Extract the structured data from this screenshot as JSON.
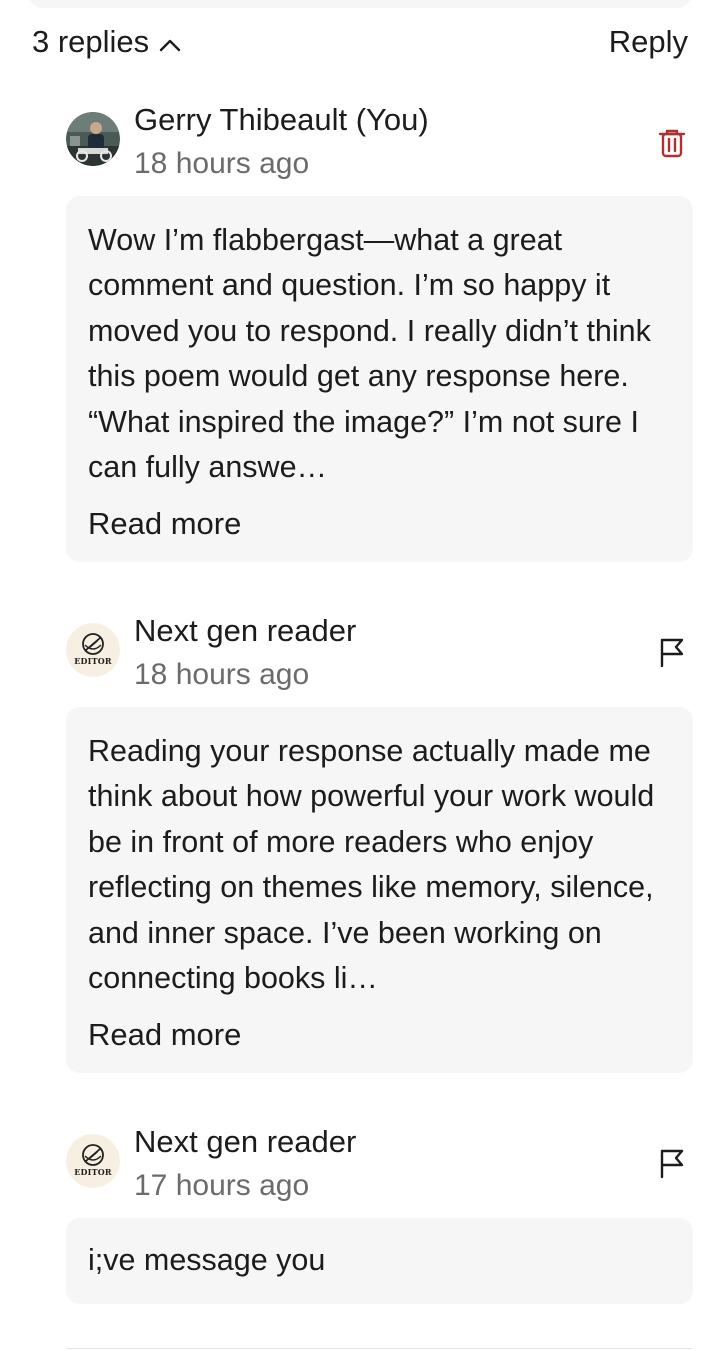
{
  "thread": {
    "replies_count_label": "3 replies",
    "replies_toggle_icon": "chevron-up-icon",
    "reply_label": "Reply"
  },
  "comments": [
    {
      "author": "Gerry Thibeault (You)",
      "timestamp": "18 hours ago",
      "avatar": "user-photo-avatar",
      "action_icon": "trash-icon",
      "text": "Wow I’m flabbergast—what a great comment and question. I’m so happy it moved you to respond. I really didn’t think this poem would get any response here. “What inspired the image?” I’m not sure I can fully answe…",
      "read_more": "Read more"
    },
    {
      "author": "Next gen reader",
      "timestamp": "18 hours ago",
      "avatar": "editor-logo-avatar",
      "avatar_text": "EDITOR",
      "action_icon": "flag-icon",
      "text": "Reading your response actually made me think about how powerful your work would be in front of more readers who enjoy reflecting on themes like memory, silence, and inner space. I’ve been working on connecting books li…",
      "read_more": "Read more"
    },
    {
      "author": "Next gen reader",
      "timestamp": "17 hours ago",
      "avatar": "editor-logo-avatar",
      "avatar_text": "EDITOR",
      "action_icon": "flag-icon",
      "text": "i;ve message you"
    }
  ],
  "colors": {
    "text": "#1c1c1c",
    "muted": "#6b6b6b",
    "bubble": "#f6f6f6",
    "delete": "#b03030"
  }
}
